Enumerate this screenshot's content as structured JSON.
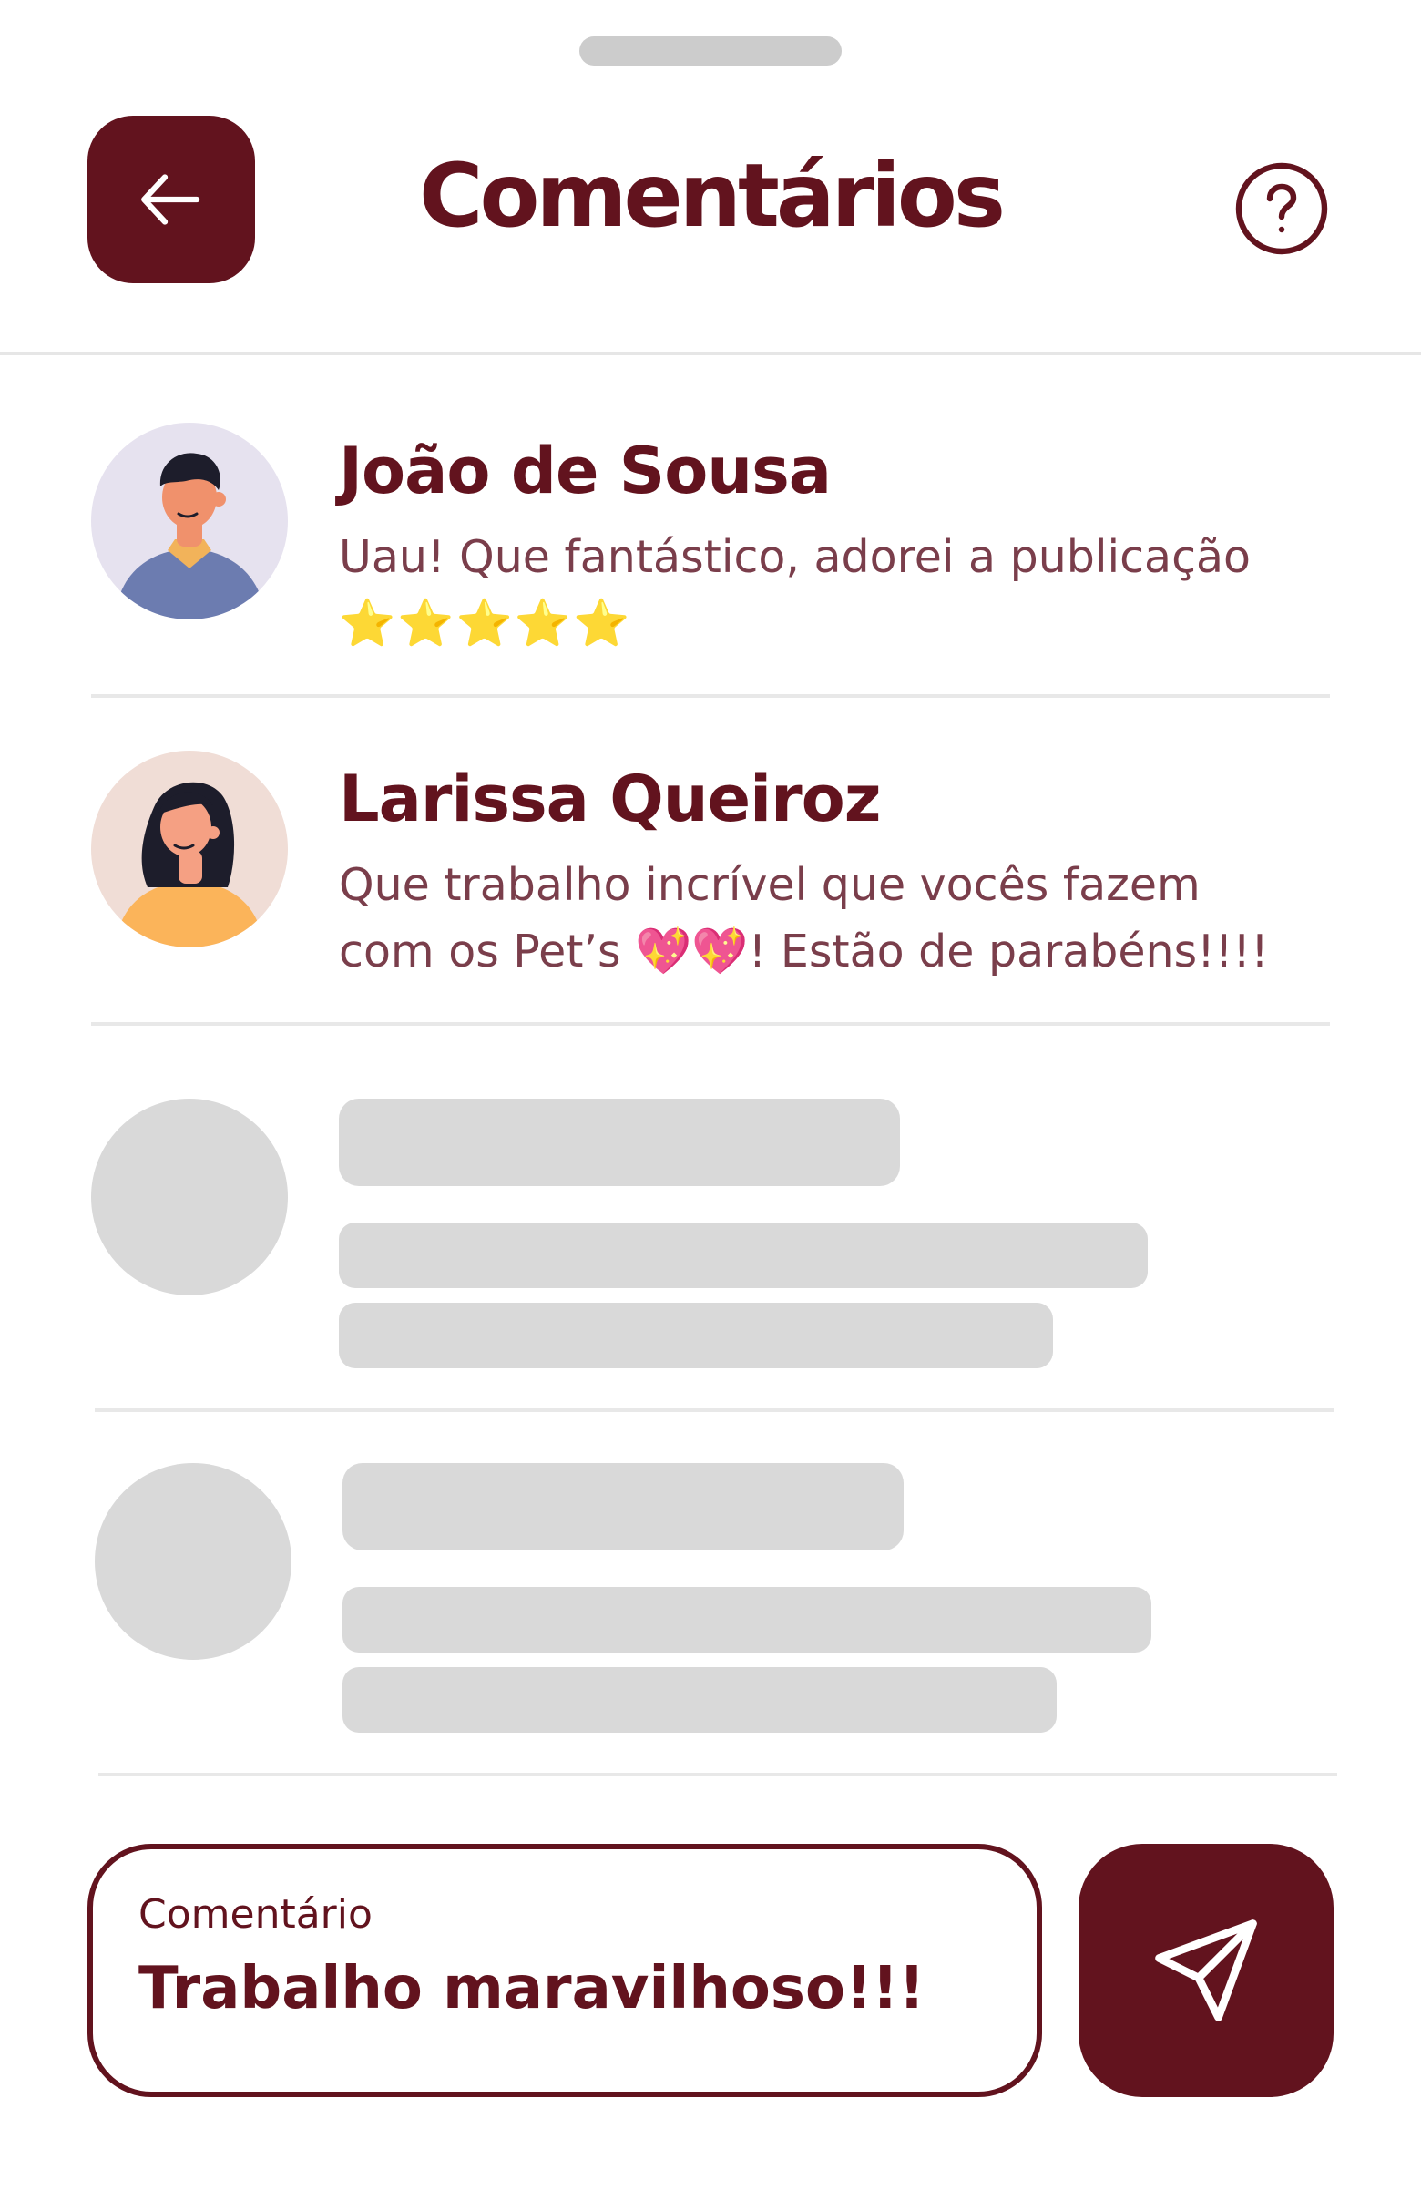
{
  "header": {
    "title": "Comentários",
    "back_icon": "arrow-left-icon",
    "help_icon": "help-circle-icon"
  },
  "comments": [
    {
      "name": "João de Sousa",
      "text": "Uau! Que fantástico, adorei a publicação",
      "emoji": "⭐⭐⭐⭐⭐",
      "avatar_bg": "#e6e2ef"
    },
    {
      "name": "Larissa Queiroz",
      "text_line1": "Que trabalho incrível que vocês fazem",
      "text_before_emoji": "com os Pet’s",
      "emoji": "💖💖",
      "text_after_emoji": "! Estão de parabéns!!!!",
      "avatar_bg": "#f0ddd6"
    }
  ],
  "composer": {
    "label": "Comentário",
    "value": "Trabalho maravilhoso!!!",
    "send_icon": "send-icon"
  },
  "colors": {
    "primary": "#62131e",
    "comment_text": "#7a3e4b",
    "skeleton": "#d9d9d9",
    "divider": "#e8e8e8"
  }
}
